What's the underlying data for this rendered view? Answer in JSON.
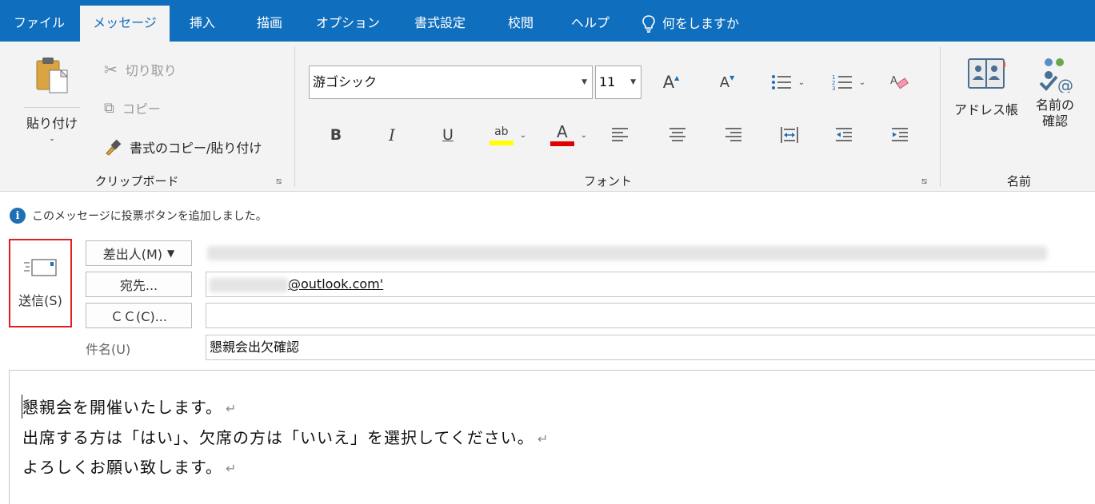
{
  "tabs": [
    {
      "label": "ファイル"
    },
    {
      "label": "メッセージ"
    },
    {
      "label": "挿入"
    },
    {
      "label": "描画"
    },
    {
      "label": "オプション"
    },
    {
      "label": "書式設定"
    },
    {
      "label": "校閲"
    },
    {
      "label": "ヘルプ"
    }
  ],
  "active_tab": "メッセージ",
  "tell_me": {
    "label": "何をしますか",
    "icon": "lightbulb-icon"
  },
  "clipboard": {
    "paste_label": "貼り付け",
    "cut_label": "切り取り",
    "copy_label": "コピー",
    "format_painter_label": "書式のコピー/貼り付け",
    "group_label": "クリップボード"
  },
  "font": {
    "font_name": "游ゴシック",
    "font_size": "11",
    "group_label": "フォント",
    "bold": "B",
    "italic": "I",
    "underline": "U",
    "grow_font": "A",
    "shrink_font": "A",
    "font_color_glyph": "A",
    "highlight_glyph": "ab",
    "highlight_color": "#ffff00",
    "font_color": "#e00000"
  },
  "names": {
    "address_book_label": "アドレス帳",
    "check_names_label_1": "名前の",
    "check_names_label_2": "確認",
    "group_label": "名前"
  },
  "info_message": "このメッセージに投票ボタンを追加しました。",
  "compose": {
    "send_label": "送信(S)",
    "from_label": "差出人(M)",
    "to_label": "宛先...",
    "cc_label": "ＣＣ(C)...",
    "subject_label": "件名(U)",
    "to_value_visible": "@outlook.com'",
    "subject_value": "懇親会出欠確認"
  },
  "body": {
    "lines": [
      "懇親会を開催いたします。",
      "出席する方は「はい」、欠席の方は「いいえ」を選択してください。",
      "よろしくお願い致します。"
    ],
    "paragraph_mark": "↵"
  },
  "colors": {
    "tab_bar": "#106ebe",
    "ribbon_bg": "#f3f3f3",
    "send_highlight": "#e02020"
  }
}
